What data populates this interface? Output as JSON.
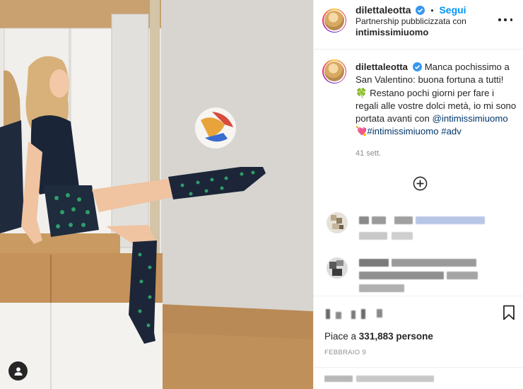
{
  "post": {
    "header": {
      "username": "dilettaleotta",
      "separator": "•",
      "follow_label": "Segui",
      "partnership_text": "Partnership pubblicizzata con",
      "partner": "intimissimiuomo",
      "more_icon": "more-horizontal-icon"
    },
    "caption": {
      "username": "dilettaleotta",
      "text_1": "Manca pochissimo a San Valentino: buona fortuna a tutti!",
      "emoji_1": "🍀",
      "text_2": "Restano pochi giorni per fare i regali alle vostre dolci metà, io mi sono portata avanti con",
      "mention": "@intimissimiuomo",
      "emoji_2": "💘",
      "hashtag_1": "#intimissimiuomo",
      "hashtag_2": "#adv",
      "time": "41 sett."
    },
    "likes_prefix": "Piace a",
    "likes_count": "331,883",
    "likes_suffix": "persone",
    "date": "FEBBRAIO 9",
    "colors": {
      "link": "#00376b",
      "follow": "#0095f6",
      "muted": "#8e8e8e",
      "verified": "#3897f0"
    }
  }
}
